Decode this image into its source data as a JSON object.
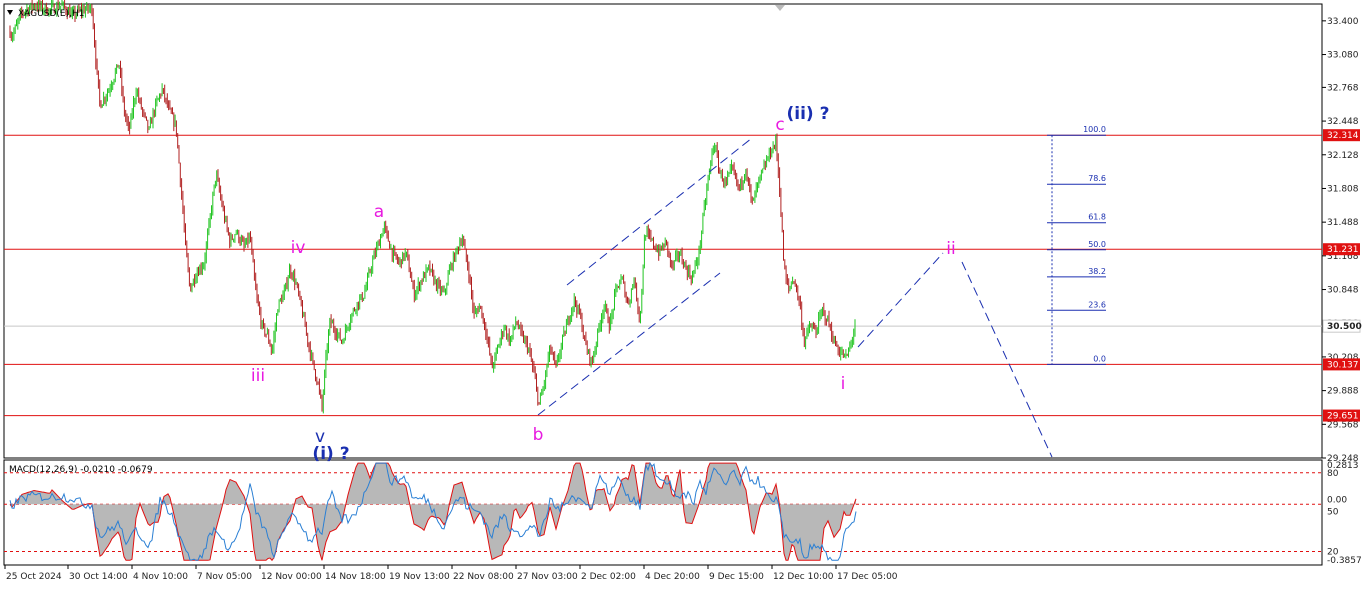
{
  "header": {
    "symbol": "XAGUSD(E),H1"
  },
  "colors": {
    "bull": "#22c422",
    "bear": "#b02020",
    "level": "#e01010",
    "magenta": "#e81ae0",
    "navy": "#1a2fb0",
    "macd_signal": "#e01010",
    "macd_main": "#2a7fd4",
    "hist": "#b8b8b8"
  },
  "price_axis": {
    "ticks": [
      "33.400",
      "33.080",
      "32.768",
      "32.448",
      "32.128",
      "31.808",
      "31.488",
      "31.168",
      "30.848",
      "30.528",
      "30.208",
      "29.888",
      "29.568",
      "29.248"
    ],
    "tick_values": [
      33.4,
      33.08,
      32.768,
      32.448,
      32.128,
      31.808,
      31.488,
      31.168,
      30.848,
      30.528,
      30.208,
      29.888,
      29.568,
      29.248
    ],
    "levels": [
      {
        "value": 32.314,
        "label": "32.314"
      },
      {
        "value": 31.231,
        "label": "31.231"
      },
      {
        "value": 30.137,
        "label": "30.137"
      },
      {
        "value": 29.651,
        "label": "29.651"
      }
    ],
    "current": {
      "value": 30.5,
      "label": "30.500"
    }
  },
  "time_axis": [
    "25 Oct 2024",
    "30 Oct 14:00",
    "4 Nov 10:00",
    "7 Nov 05:00",
    "12 Nov 00:00",
    "14 Nov 18:00",
    "19 Nov 13:00",
    "22 Nov 08:00",
    "27 Nov 03:00",
    "2 Dec 02:00",
    "4 Dec 20:00",
    "9 Dec 15:00",
    "12 Dec 10:00",
    "17 Dec 05:00"
  ],
  "macd": {
    "label": "MACD(12,26,9) -0.0210 -0.0679",
    "axis": [
      "0.2813",
      "80",
      "0.00",
      "50",
      "20",
      "-0.3857"
    ]
  },
  "fib_levels": [
    {
      "label": "100.0"
    },
    {
      "label": "78.6"
    },
    {
      "label": "61.8"
    },
    {
      "label": "50.0"
    },
    {
      "label": "38.2"
    },
    {
      "label": "23.6"
    },
    {
      "label": "0.0"
    }
  ],
  "waves": [
    {
      "text": "iii"
    },
    {
      "text": "iv"
    },
    {
      "text": "v"
    },
    {
      "text": "(i) ?"
    },
    {
      "text": "a"
    },
    {
      "text": "b"
    },
    {
      "text": "c"
    },
    {
      "text": "(ii) ?"
    },
    {
      "text": "i"
    },
    {
      "text": "ii"
    }
  ],
  "chart_data": {
    "type": "candlestick",
    "symbol": "XAGUSD(E),H1",
    "ylim": [
      29.248,
      33.56
    ],
    "path_points": [
      [
        0,
        33.45
      ],
      [
        8,
        33.25
      ],
      [
        18,
        33.48
      ],
      [
        30,
        33.55
      ],
      [
        45,
        33.5
      ],
      [
        58,
        33.55
      ],
      [
        68,
        33.45
      ],
      [
        78,
        33.5
      ],
      [
        88,
        33.52
      ],
      [
        92,
        33.0
      ],
      [
        96,
        32.6
      ],
      [
        105,
        32.75
      ],
      [
        115,
        33.0
      ],
      [
        120,
        32.55
      ],
      [
        125,
        32.35
      ],
      [
        132,
        32.75
      ],
      [
        138,
        32.55
      ],
      [
        145,
        32.35
      ],
      [
        150,
        32.55
      ],
      [
        158,
        32.75
      ],
      [
        165,
        32.55
      ],
      [
        172,
        32.4
      ],
      [
        178,
        31.7
      ],
      [
        182,
        31.2
      ],
      [
        186,
        30.85
      ],
      [
        192,
        31.0
      ],
      [
        200,
        31.1
      ],
      [
        205,
        31.45
      ],
      [
        212,
        31.95
      ],
      [
        220,
        31.55
      ],
      [
        226,
        31.3
      ],
      [
        232,
        31.4
      ],
      [
        240,
        31.25
      ],
      [
        246,
        31.35
      ],
      [
        252,
        30.8
      ],
      [
        258,
        30.5
      ],
      [
        264,
        30.4
      ],
      [
        268,
        30.25
      ],
      [
        274,
        30.7
      ],
      [
        280,
        30.8
      ],
      [
        286,
        31.05
      ],
      [
        292,
        30.9
      ],
      [
        298,
        30.65
      ],
      [
        304,
        30.35
      ],
      [
        310,
        30.1
      ],
      [
        314,
        29.95
      ],
      [
        318,
        29.72
      ],
      [
        322,
        30.2
      ],
      [
        326,
        30.55
      ],
      [
        332,
        30.45
      ],
      [
        338,
        30.35
      ],
      [
        345,
        30.55
      ],
      [
        352,
        30.7
      ],
      [
        360,
        30.8
      ],
      [
        368,
        31.1
      ],
      [
        375,
        31.3
      ],
      [
        380,
        31.45
      ],
      [
        388,
        31.2
      ],
      [
        395,
        31.1
      ],
      [
        402,
        31.2
      ],
      [
        410,
        30.8
      ],
      [
        418,
        30.95
      ],
      [
        425,
        31.05
      ],
      [
        432,
        30.9
      ],
      [
        440,
        30.8
      ],
      [
        446,
        31.05
      ],
      [
        452,
        31.2
      ],
      [
        458,
        31.35
      ],
      [
        465,
        31.0
      ],
      [
        470,
        30.6
      ],
      [
        476,
        30.7
      ],
      [
        482,
        30.45
      ],
      [
        488,
        30.1
      ],
      [
        494,
        30.3
      ],
      [
        500,
        30.5
      ],
      [
        506,
        30.35
      ],
      [
        512,
        30.55
      ],
      [
        518,
        30.4
      ],
      [
        524,
        30.3
      ],
      [
        530,
        30.05
      ],
      [
        535,
        29.75
      ],
      [
        540,
        29.95
      ],
      [
        546,
        30.3
      ],
      [
        552,
        30.1
      ],
      [
        558,
        30.35
      ],
      [
        564,
        30.55
      ],
      [
        570,
        30.75
      ],
      [
        576,
        30.6
      ],
      [
        582,
        30.3
      ],
      [
        588,
        30.15
      ],
      [
        594,
        30.45
      ],
      [
        600,
        30.7
      ],
      [
        606,
        30.5
      ],
      [
        612,
        30.85
      ],
      [
        618,
        30.95
      ],
      [
        624,
        30.7
      ],
      [
        630,
        30.95
      ],
      [
        636,
        30.55
      ],
      [
        641,
        31.4
      ],
      [
        648,
        31.3
      ],
      [
        655,
        31.2
      ],
      [
        662,
        31.3
      ],
      [
        668,
        31.05
      ],
      [
        675,
        31.2
      ],
      [
        682,
        31.05
      ],
      [
        688,
        30.95
      ],
      [
        695,
        31.2
      ],
      [
        700,
        31.6
      ],
      [
        705,
        31.95
      ],
      [
        710,
        32.25
      ],
      [
        716,
        31.95
      ],
      [
        722,
        31.85
      ],
      [
        728,
        32.0
      ],
      [
        735,
        31.8
      ],
      [
        742,
        32.0
      ],
      [
        748,
        31.65
      ],
      [
        754,
        31.85
      ],
      [
        760,
        32.0
      ],
      [
        766,
        32.15
      ],
      [
        772,
        32.25
      ],
      [
        776,
        31.75
      ],
      [
        780,
        31.05
      ],
      [
        784,
        30.85
      ],
      [
        790,
        30.95
      ],
      [
        796,
        30.7
      ],
      [
        800,
        30.35
      ],
      [
        806,
        30.5
      ],
      [
        812,
        30.45
      ],
      [
        818,
        30.65
      ],
      [
        824,
        30.55
      ],
      [
        830,
        30.35
      ],
      [
        836,
        30.25
      ],
      [
        842,
        30.2
      ],
      [
        846,
        30.3
      ],
      [
        852,
        30.55
      ]
    ],
    "fib_retracement": {
      "high": 32.314,
      "low": 30.137,
      "levels": [
        100.0,
        78.6,
        61.8,
        50.0,
        38.2,
        23.6,
        0.0
      ]
    },
    "macd": {
      "fast": 12,
      "slow": 26,
      "signal": 9,
      "main": -0.021,
      "signal_value": -0.0679,
      "ylim": [
        -0.3857,
        0.2813
      ]
    }
  }
}
